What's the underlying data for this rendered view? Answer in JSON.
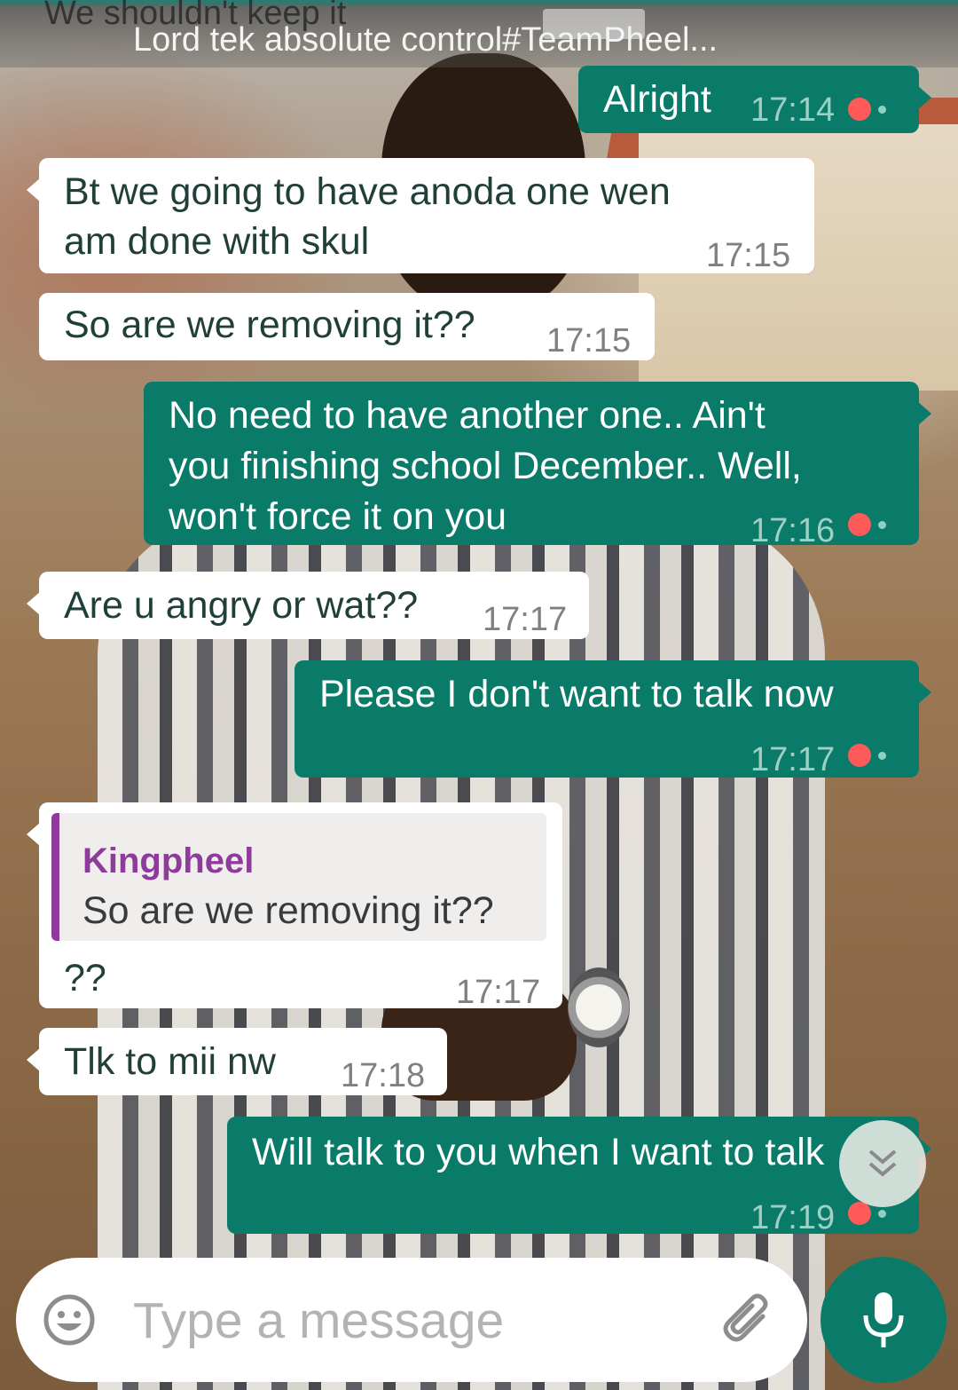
{
  "header": {
    "previous_message_fragment": "We shouldn't keep it",
    "chat_title": "Lord tek absolute control#TeamPheel..."
  },
  "messages": [
    {
      "direction": "outgoing",
      "lines": [
        "Alright"
      ],
      "time": "17:14",
      "status": "sent"
    },
    {
      "direction": "incoming",
      "lines": [
        "Bt we going to have anoda one wen",
        "am done with skul"
      ],
      "time": "17:15"
    },
    {
      "direction": "incoming",
      "lines": [
        "So are we removing it??"
      ],
      "time": "17:15"
    },
    {
      "direction": "outgoing",
      "lines": [
        "No need to have another one.. Ain't",
        "you finishing school December.. Well,",
        "won't force it on you"
      ],
      "time": "17:16",
      "status": "sent"
    },
    {
      "direction": "incoming",
      "lines": [
        "Are u angry or wat??"
      ],
      "time": "17:17"
    },
    {
      "direction": "outgoing",
      "lines": [
        "Please I don't want to talk now"
      ],
      "time": "17:17",
      "status": "sent"
    },
    {
      "direction": "incoming",
      "quoted": {
        "author": "Kingpheel",
        "text": "So are we removing it??"
      },
      "lines": [
        "??"
      ],
      "time": "17:17"
    },
    {
      "direction": "incoming",
      "lines": [
        "Tlk to mii nw"
      ],
      "time": "17:18"
    },
    {
      "direction": "outgoing",
      "lines": [
        "Will talk to you when I want to talk"
      ],
      "time": "17:19",
      "status": "sent"
    }
  ],
  "composer": {
    "placeholder": "Type a message",
    "emoji_icon": "emoji-icon",
    "attach_icon": "paperclip-icon",
    "mic_icon": "microphone-icon"
  },
  "scroll_button_icon": "double-chevron-down-icon",
  "colors": {
    "outgoing_bubble": "#0a7b69",
    "incoming_bubble": "#ffffff",
    "quote_author": "#8f3b9b",
    "status_dot": "#ff5a5a"
  }
}
